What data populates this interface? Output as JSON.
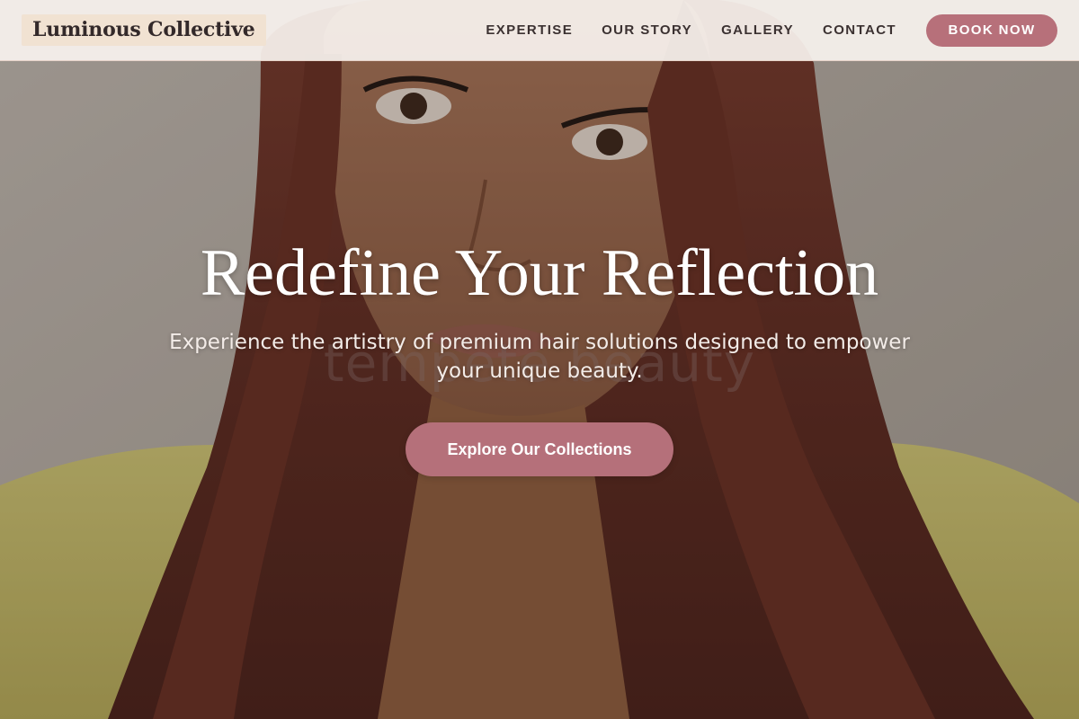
{
  "header": {
    "logo_text": "Luminous Collective",
    "nav": [
      {
        "label": "EXPERTISE"
      },
      {
        "label": "OUR STORY"
      },
      {
        "label": "GALLERY"
      },
      {
        "label": "CONTACT"
      }
    ],
    "book_label": "BOOK NOW"
  },
  "hero": {
    "headline": "Redefine Your Reflection",
    "subtitle": "Experience the artistry of premium hair solutions designed to empower your unique beauty.",
    "cta_label": "Explore Our Collections",
    "watermark_text": "tempete beauty",
    "image_description_icon": "portrait-photo"
  },
  "colors": {
    "accent": "#b7707a",
    "header_bg": "#f8f2ee",
    "logo_bg": "#f1e2d2",
    "nav_text": "#3b3131",
    "headline": "#ffffff"
  }
}
